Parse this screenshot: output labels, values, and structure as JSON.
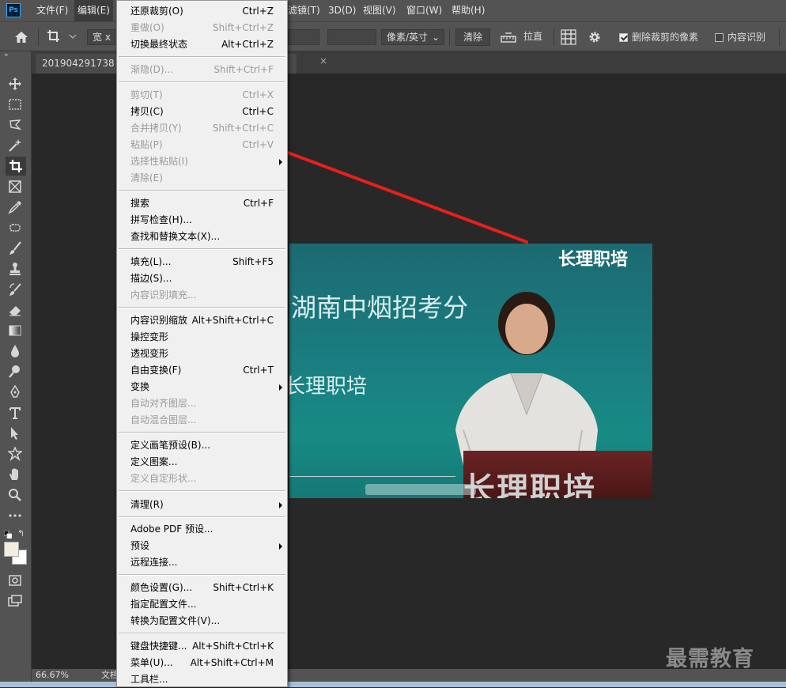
{
  "menubar": {
    "logo": "Ps",
    "items": [
      "文件(F)",
      "编辑(E)",
      "滤镜(T)",
      "3D(D)",
      "视图(V)",
      "窗口(W)",
      "帮助(H)"
    ]
  },
  "options": {
    "width_label": "宽 x",
    "unit_select": "像素/英寸",
    "clear_label": "清除",
    "straighten_label": "拉直",
    "delete_cropped_label": "删除裁剪的像素",
    "content_aware_label": "内容识别"
  },
  "tab": {
    "title": "201904291738",
    "close": "×"
  },
  "status": {
    "zoom": "66.67%",
    "doc": "文档"
  },
  "photo": {
    "logo_text": "长理职培",
    "headline": "湖南中烟招考分",
    "sub_text": "长理职培",
    "bottom_text": "长理职培"
  },
  "watermark": "最需教育",
  "colors": {
    "arrow": "#e8201a",
    "menu_bg": "#f0f0f0",
    "ui_dark": "#535353"
  },
  "edit_menu": {
    "items": [
      {
        "label": "还原裁剪(O)",
        "shortcut": "Ctrl+Z",
        "enabled": true,
        "submenu": false
      },
      {
        "label": "重做(O)",
        "shortcut": "Shift+Ctrl+Z",
        "enabled": false,
        "submenu": false
      },
      {
        "label": "切换最终状态",
        "shortcut": "Alt+Ctrl+Z",
        "enabled": true,
        "submenu": false
      },
      {
        "label": "渐隐(D)...",
        "shortcut": "Shift+Ctrl+F",
        "enabled": false,
        "submenu": false
      },
      {
        "label": "剪切(T)",
        "shortcut": "Ctrl+X",
        "enabled": false,
        "submenu": false
      },
      {
        "label": "拷贝(C)",
        "shortcut": "Ctrl+C",
        "enabled": true,
        "submenu": false
      },
      {
        "label": "合并拷贝(Y)",
        "shortcut": "Shift+Ctrl+C",
        "enabled": false,
        "submenu": false
      },
      {
        "label": "粘贴(P)",
        "shortcut": "Ctrl+V",
        "enabled": false,
        "submenu": false
      },
      {
        "label": "选择性粘贴(I)",
        "shortcut": "",
        "enabled": false,
        "submenu": true
      },
      {
        "label": "清除(E)",
        "shortcut": "",
        "enabled": false,
        "submenu": false
      },
      {
        "label": "搜索",
        "shortcut": "Ctrl+F",
        "enabled": true,
        "submenu": false
      },
      {
        "label": "拼写检查(H)...",
        "shortcut": "",
        "enabled": true,
        "submenu": false
      },
      {
        "label": "查找和替换文本(X)...",
        "shortcut": "",
        "enabled": true,
        "submenu": false
      },
      {
        "label": "填充(L)...",
        "shortcut": "Shift+F5",
        "enabled": true,
        "submenu": false
      },
      {
        "label": "描边(S)...",
        "shortcut": "",
        "enabled": true,
        "submenu": false
      },
      {
        "label": "内容识别填充...",
        "shortcut": "",
        "enabled": false,
        "submenu": false
      },
      {
        "label": "内容识别缩放",
        "shortcut": "Alt+Shift+Ctrl+C",
        "enabled": true,
        "submenu": false
      },
      {
        "label": "操控变形",
        "shortcut": "",
        "enabled": true,
        "submenu": false
      },
      {
        "label": "透视变形",
        "shortcut": "",
        "enabled": true,
        "submenu": false
      },
      {
        "label": "自由变换(F)",
        "shortcut": "Ctrl+T",
        "enabled": true,
        "submenu": false
      },
      {
        "label": "变换",
        "shortcut": "",
        "enabled": true,
        "submenu": true
      },
      {
        "label": "自动对齐图层...",
        "shortcut": "",
        "enabled": false,
        "submenu": false
      },
      {
        "label": "自动混合图层...",
        "shortcut": "",
        "enabled": false,
        "submenu": false
      },
      {
        "label": "定义画笔预设(B)...",
        "shortcut": "",
        "enabled": true,
        "submenu": false
      },
      {
        "label": "定义图案...",
        "shortcut": "",
        "enabled": true,
        "submenu": false
      },
      {
        "label": "定义自定形状...",
        "shortcut": "",
        "enabled": false,
        "submenu": false
      },
      {
        "label": "清理(R)",
        "shortcut": "",
        "enabled": true,
        "submenu": true
      },
      {
        "label": "Adobe PDF 预设...",
        "shortcut": "",
        "enabled": true,
        "submenu": false
      },
      {
        "label": "预设",
        "shortcut": "",
        "enabled": true,
        "submenu": true
      },
      {
        "label": "远程连接...",
        "shortcut": "",
        "enabled": true,
        "submenu": false
      },
      {
        "label": "颜色设置(G)...",
        "shortcut": "Shift+Ctrl+K",
        "enabled": true,
        "submenu": false
      },
      {
        "label": "指定配置文件...",
        "shortcut": "",
        "enabled": true,
        "submenu": false
      },
      {
        "label": "转换为配置文件(V)...",
        "shortcut": "",
        "enabled": true,
        "submenu": false
      },
      {
        "label": "键盘快捷键...",
        "shortcut": "Alt+Shift+Ctrl+K",
        "enabled": true,
        "submenu": false
      },
      {
        "label": "菜单(U)...",
        "shortcut": "Alt+Shift+Ctrl+M",
        "enabled": true,
        "submenu": false
      },
      {
        "label": "工具栏...",
        "shortcut": "",
        "enabled": true,
        "submenu": false
      }
    ]
  }
}
